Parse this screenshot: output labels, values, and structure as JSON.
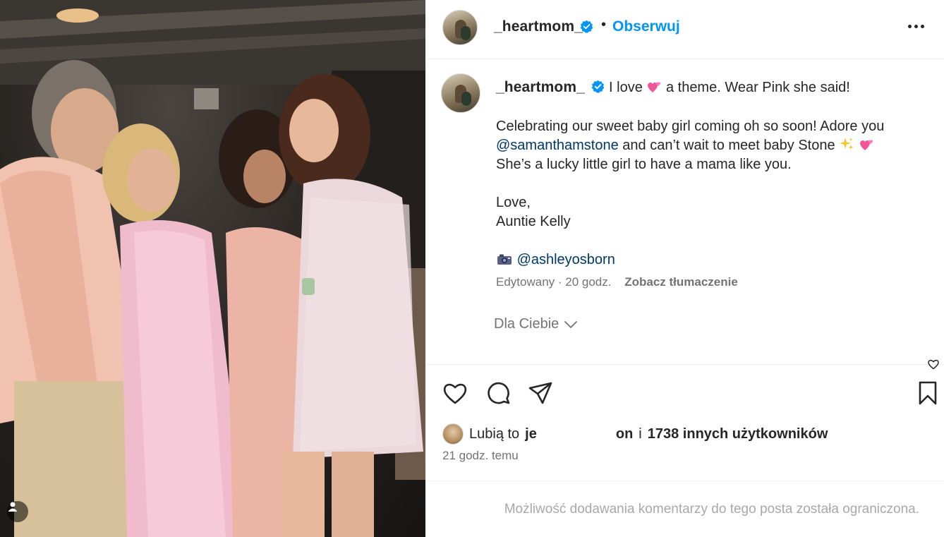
{
  "photo": {
    "description_icon": "tagged-user-icon"
  },
  "header": {
    "username": "_heartmom_",
    "separator": "•",
    "follow_label": "Obserwuj",
    "more_icon": "more-options-icon"
  },
  "caption": {
    "username": "_heartmom_",
    "line1_before": "I love",
    "line1_after": "a theme. Wear Pink she said!",
    "para1_line1": "Celebrating our sweet baby girl coming oh so soon! Adore you",
    "para1_mention": "@samanthamstone",
    "para1_line2_after": "and can’t wait to meet baby Stone",
    "para1_line3": "She’s a lucky little girl to have a mama like you.",
    "signoff1": "Love,",
    "signoff2": "Auntie Kelly",
    "credit_mention": "@ashleyosborn",
    "edited": "Edytowany · 20 godz.",
    "translate": "Zobacz tłumaczenie",
    "for_you": "Dla Ciebie"
  },
  "actions": {
    "likes_prefix": "Lubią to",
    "likes_name_start": "je",
    "likes_name_end": "on",
    "likes_conjunction": "i",
    "likes_count_text": "1738 innych użytkowników",
    "timestamp": "21 godz. temu"
  },
  "comments": {
    "restricted_text": "Możliwość dodawania komentarzy do tego posta została ograniczona."
  },
  "colors": {
    "accent": "#0095f6",
    "mention": "#00376b",
    "muted": "#737373",
    "text": "#262626"
  }
}
